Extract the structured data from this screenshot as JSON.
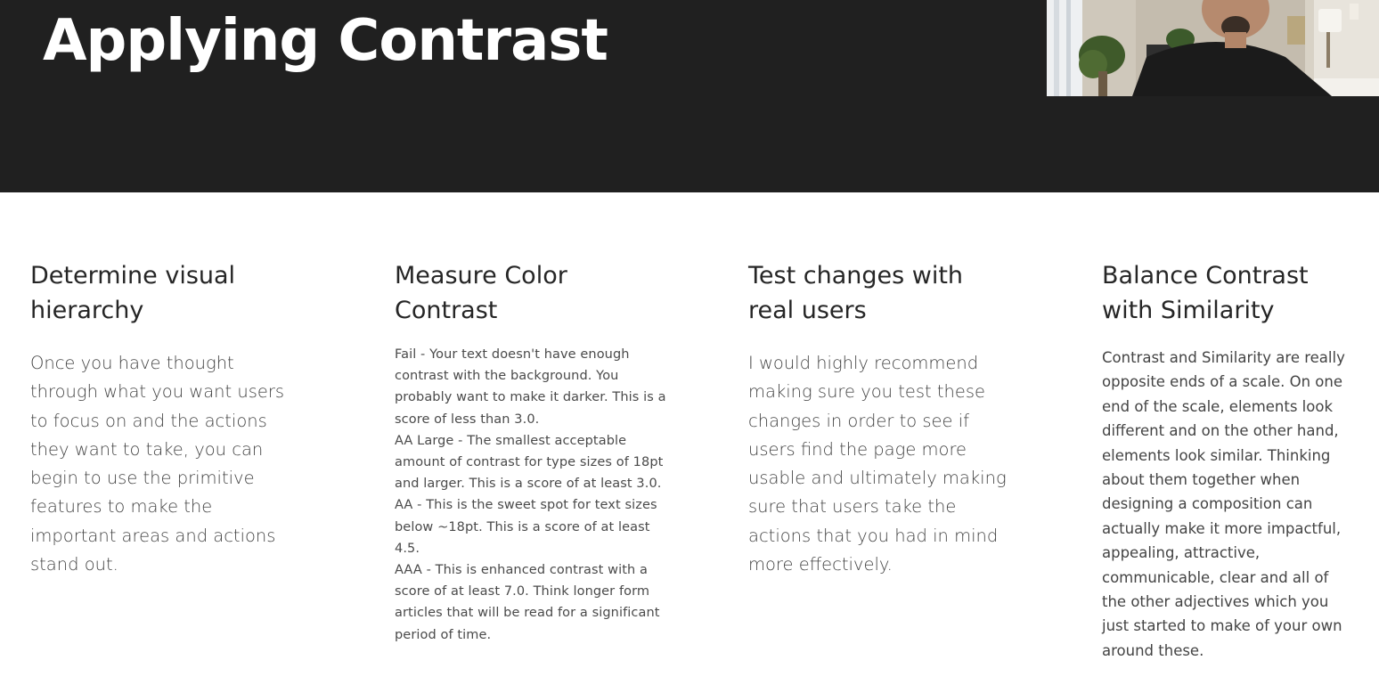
{
  "slide": {
    "title": "Applying Contrast"
  },
  "columns": [
    {
      "heading": "Determine visual hierarchy",
      "text": "Once you have thought through what you want users to focus on and the actions they want to take, you can begin to use the primitive features to make the important areas and actions stand out."
    },
    {
      "heading": "Measure Color Contrast",
      "text": "Fail - Your text doesn't have enough contrast with the background. You probably want to make it darker. This is a score of less than 3.0.\nAA Large - The smallest acceptable amount of contrast for type sizes of 18pt and larger. This is a score of at least 3.0.\nAA - This is the sweet spot for text sizes below ~18pt. This is a score of at least 4.5.\nAAA - This is enhanced contrast with a score of at least 7.0. Think longer form articles that will be read for a significant period of time."
    },
    {
      "heading": "Test changes with real users",
      "text": "I would highly recommend making sure you test these changes in order to see if users find the page more usable and ultimately making sure that users take the actions that you had in mind more effectively."
    },
    {
      "heading": "Balance Contrast with Similarity",
      "text": "Contrast and Similarity are really opposite ends of a scale. On one end of the scale, elements look different and on the other hand, elements look similar. Thinking about them together when designing a composition can actually make it more impactful, appealing, attractive, communicable, clear and all of the other adjectives which you just started to make of your own around these."
    }
  ],
  "colors": {
    "header_bg": "#202020",
    "title": "#ffffff",
    "heading": "#262626",
    "body_text": "#444444"
  }
}
